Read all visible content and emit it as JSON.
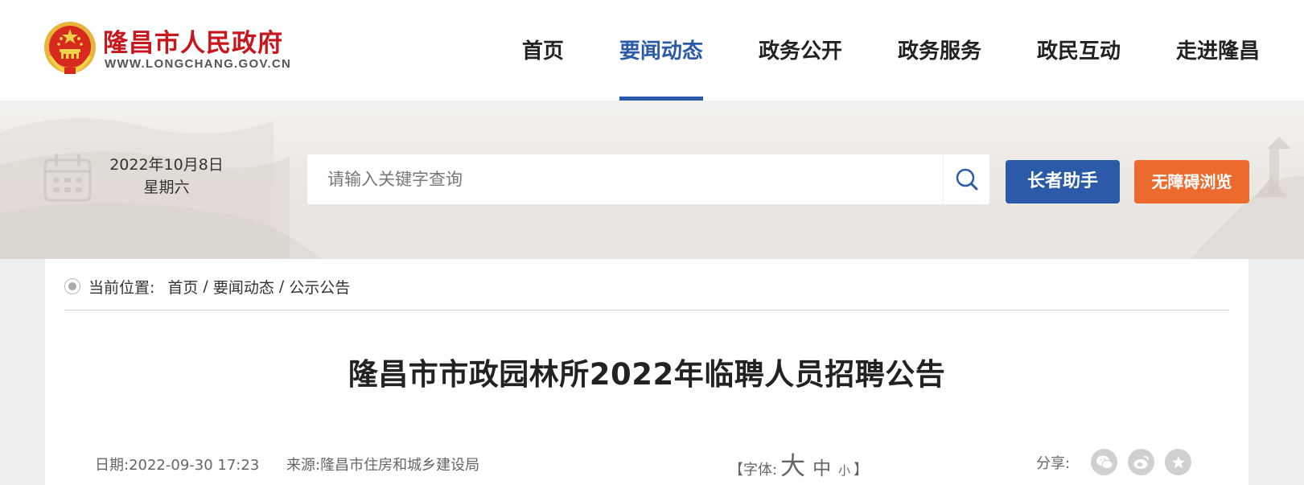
{
  "header": {
    "site_name": "隆昌市人民政府",
    "site_domain": "WWW.LONGCHANG.GOV.CN",
    "nav": [
      {
        "label": "首页",
        "active": false
      },
      {
        "label": "要闻动态",
        "active": true
      },
      {
        "label": "政务公开",
        "active": false
      },
      {
        "label": "政务服务",
        "active": false
      },
      {
        "label": "政民互动",
        "active": false
      },
      {
        "label": "走进隆昌",
        "active": false
      }
    ]
  },
  "banner": {
    "date": "2022年10月8日",
    "weekday": "星期六",
    "search_placeholder": "请输入关键字查询",
    "elder_button": "长者助手",
    "accessibility_button": "无障碍浏览"
  },
  "breadcrumb": {
    "label": "当前位置:",
    "items": [
      "首页",
      "要闻动态",
      "公示公告"
    ],
    "separator": "/"
  },
  "article": {
    "title": "隆昌市市政园林所2022年临聘人员招聘公告",
    "date": "日期:2022-09-30 17:23",
    "source": "来源:隆昌市住房和城乡建设局",
    "font_size_open": "【字体:",
    "font_big": "大",
    "font_mid": "中",
    "font_small": "小",
    "font_size_close": "】",
    "share_label": "分享:"
  },
  "colors": {
    "brand_red": "#c8161d",
    "primary_blue": "#2b5ba8",
    "accent_orange": "#ec6a2e"
  },
  "icons": [
    "national-emblem-icon",
    "calendar-icon",
    "search-icon",
    "wechat-icon",
    "weibo-icon",
    "favorite-star-icon"
  ]
}
